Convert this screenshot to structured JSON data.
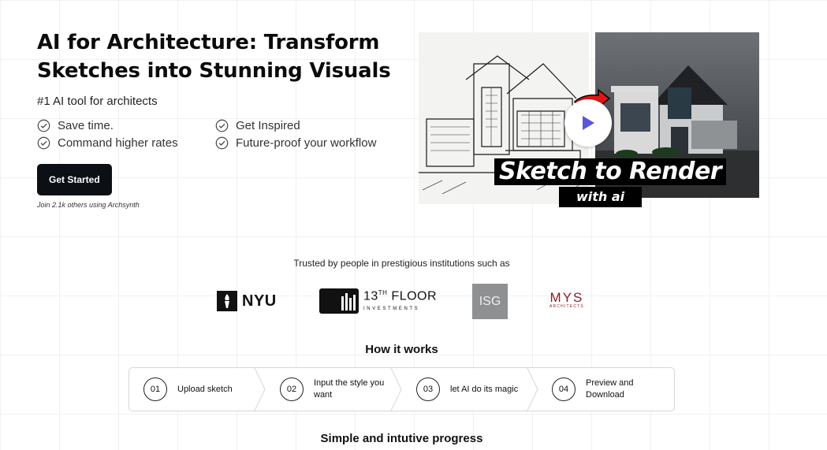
{
  "hero": {
    "title_line1": "AI for Architecture: Transform",
    "title_line2": "Sketches into Stunning Visuals",
    "subtitle": "#1 AI tool for architects",
    "features": [
      "Save time.",
      "Get Inspired",
      "Command higher rates",
      "Future-proof your workflow"
    ],
    "cta_label": "Get Started",
    "join_text": "Join 2.1k others using Archsynth"
  },
  "video": {
    "caption_main": "Sketch to Render",
    "caption_sub": "with ai",
    "icons": [
      "play-icon",
      "arrow-icon"
    ]
  },
  "trusted": {
    "text": "Trusted by people in prestigious institutions such as",
    "logos": {
      "nyu": "NYU",
      "thirteenth_floor_main": "13",
      "thirteenth_floor_sup": "TH",
      "thirteenth_floor_word": " FLOOR",
      "thirteenth_floor_sub": "INVESTMENTS",
      "isg": "ISG",
      "mys_main": "MYS",
      "mys_sub": "ARCHITECTS"
    }
  },
  "how_it_works": {
    "title": "How it works",
    "steps": [
      {
        "num": "01",
        "label": "Upload sketch"
      },
      {
        "num": "02",
        "label": "Input the style you want"
      },
      {
        "num": "03",
        "label": "let AI do its magic"
      },
      {
        "num": "04",
        "label": "Preview and Download"
      }
    ]
  },
  "progress": {
    "title": "Simple and intutive progress"
  },
  "colors": {
    "cta_bg": "#0c0f14",
    "play_icon": "#5b57d8",
    "arrow": "#e01616",
    "mys": "#8b1d24"
  }
}
